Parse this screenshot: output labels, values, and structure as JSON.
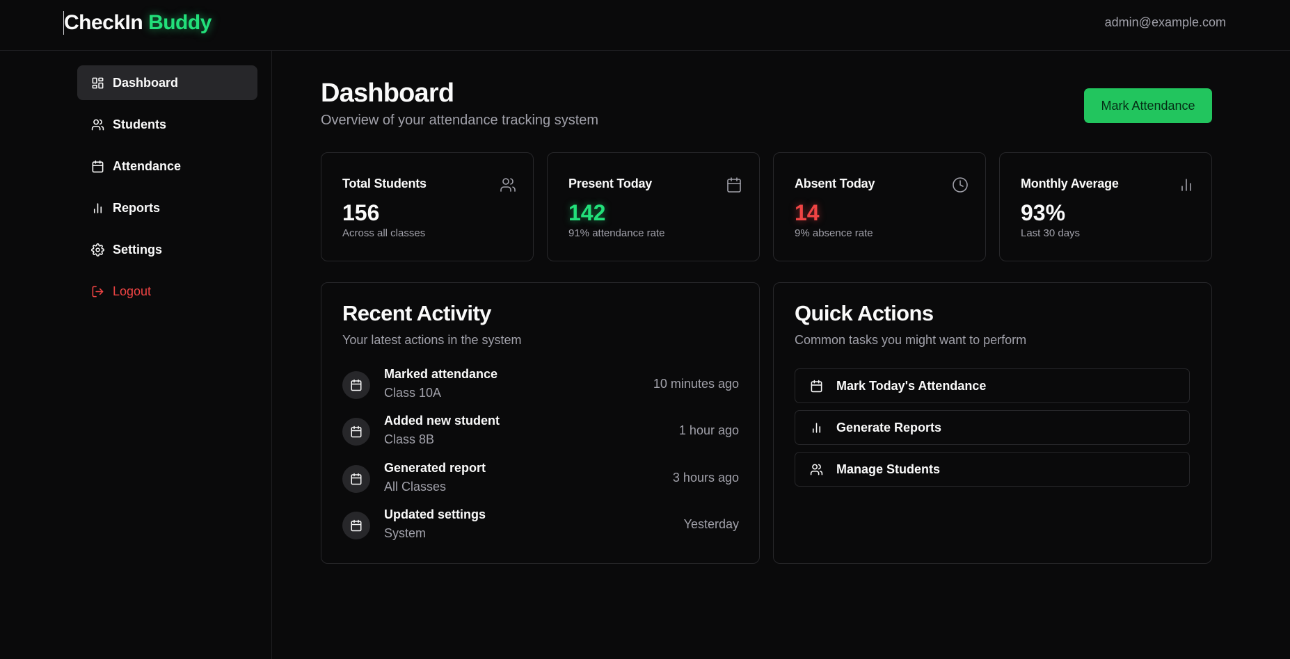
{
  "header": {
    "brand_main": "CheckIn",
    "brand_accent": "Buddy",
    "user_email": "admin@example.com"
  },
  "sidebar": {
    "items": [
      {
        "label": "Dashboard",
        "icon": "dashboard-icon",
        "active": true
      },
      {
        "label": "Students",
        "icon": "users-icon"
      },
      {
        "label": "Attendance",
        "icon": "calendar-icon"
      },
      {
        "label": "Reports",
        "icon": "bar-chart-icon"
      },
      {
        "label": "Settings",
        "icon": "gear-icon"
      },
      {
        "label": "Logout",
        "icon": "logout-icon"
      }
    ]
  },
  "main": {
    "title": "Dashboard",
    "subtitle": "Overview of your attendance tracking system",
    "primary_action": "Mark Attendance",
    "stats": [
      {
        "label": "Total Students",
        "value": "156",
        "sub": "Across all classes",
        "icon": "users-icon"
      },
      {
        "label": "Present Today",
        "value": "142",
        "sub": "91% attendance rate",
        "icon": "calendar-icon"
      },
      {
        "label": "Absent Today",
        "value": "14",
        "sub": "9% absence rate",
        "icon": "clock-icon"
      },
      {
        "label": "Monthly Average",
        "value": "93%",
        "sub": "Last 30 days",
        "icon": "bar-chart-icon"
      }
    ],
    "recent_activity": {
      "title": "Recent Activity",
      "subtitle": "Your latest actions in the system",
      "items": [
        {
          "title": "Marked attendance",
          "detail": "Class 10A",
          "time": "10 minutes ago"
        },
        {
          "title": "Added new student",
          "detail": "Class 8B",
          "time": "1 hour ago"
        },
        {
          "title": "Generated report",
          "detail": "All Classes",
          "time": "3 hours ago"
        },
        {
          "title": "Updated settings",
          "detail": "System",
          "time": "Yesterday"
        }
      ]
    },
    "quick_actions": {
      "title": "Quick Actions",
      "subtitle": "Common tasks you might want to perform",
      "items": [
        {
          "label": "Mark Today's Attendance",
          "icon": "calendar-icon"
        },
        {
          "label": "Generate Reports",
          "icon": "bar-chart-icon"
        },
        {
          "label": "Manage Students",
          "icon": "users-icon"
        }
      ]
    }
  },
  "colors": {
    "background": "#0a0a0b",
    "accent_green": "#22c55e",
    "danger_red": "#ef4444",
    "border": "#27272a",
    "muted_text": "#a1a1aa"
  }
}
